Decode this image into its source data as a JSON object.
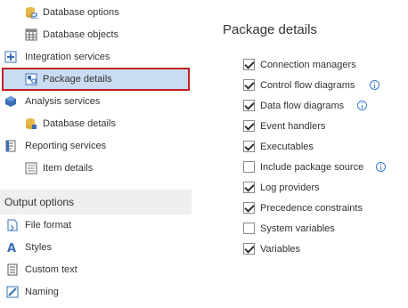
{
  "sidebar": {
    "tree": [
      {
        "label": "Database options",
        "icon": "database-options-icon"
      },
      {
        "label": "Database objects",
        "icon": "table-grid-icon"
      },
      {
        "label": "Integration services",
        "icon": "integration-services-icon"
      },
      {
        "label": "Package details",
        "icon": "package-icon",
        "selected": true
      },
      {
        "label": "Analysis services",
        "icon": "cube-icon"
      },
      {
        "label": "Database details",
        "icon": "database-icon"
      },
      {
        "label": "Reporting services",
        "icon": "report-icon"
      },
      {
        "label": "Item details",
        "icon": "list-icon"
      }
    ],
    "section_title": "Output options",
    "output_items": [
      {
        "label": "File format",
        "icon": "file-format-icon"
      },
      {
        "label": "Styles",
        "icon": "styles-icon"
      },
      {
        "label": "Custom text",
        "icon": "document-icon"
      },
      {
        "label": "Naming",
        "icon": "naming-icon"
      }
    ]
  },
  "main": {
    "title": "Package details",
    "options": [
      {
        "label": "Connection managers",
        "checked": true,
        "info": false
      },
      {
        "label": "Control flow diagrams",
        "checked": true,
        "info": true
      },
      {
        "label": "Data flow diagrams",
        "checked": true,
        "info": true
      },
      {
        "label": "Event handlers",
        "checked": true,
        "info": false
      },
      {
        "label": "Executables",
        "checked": true,
        "info": false
      },
      {
        "label": "Include package source",
        "checked": false,
        "info": true
      },
      {
        "label": "Log providers",
        "checked": true,
        "info": false
      },
      {
        "label": "Precedence constraints",
        "checked": true,
        "info": false
      },
      {
        "label": "System variables",
        "checked": false,
        "info": false
      },
      {
        "label": "Variables",
        "checked": true,
        "info": false
      }
    ]
  },
  "colors": {
    "selected_bg": "#c9dcf2",
    "selected_border": "#c42020",
    "info_blue": "#3a7bd5"
  }
}
